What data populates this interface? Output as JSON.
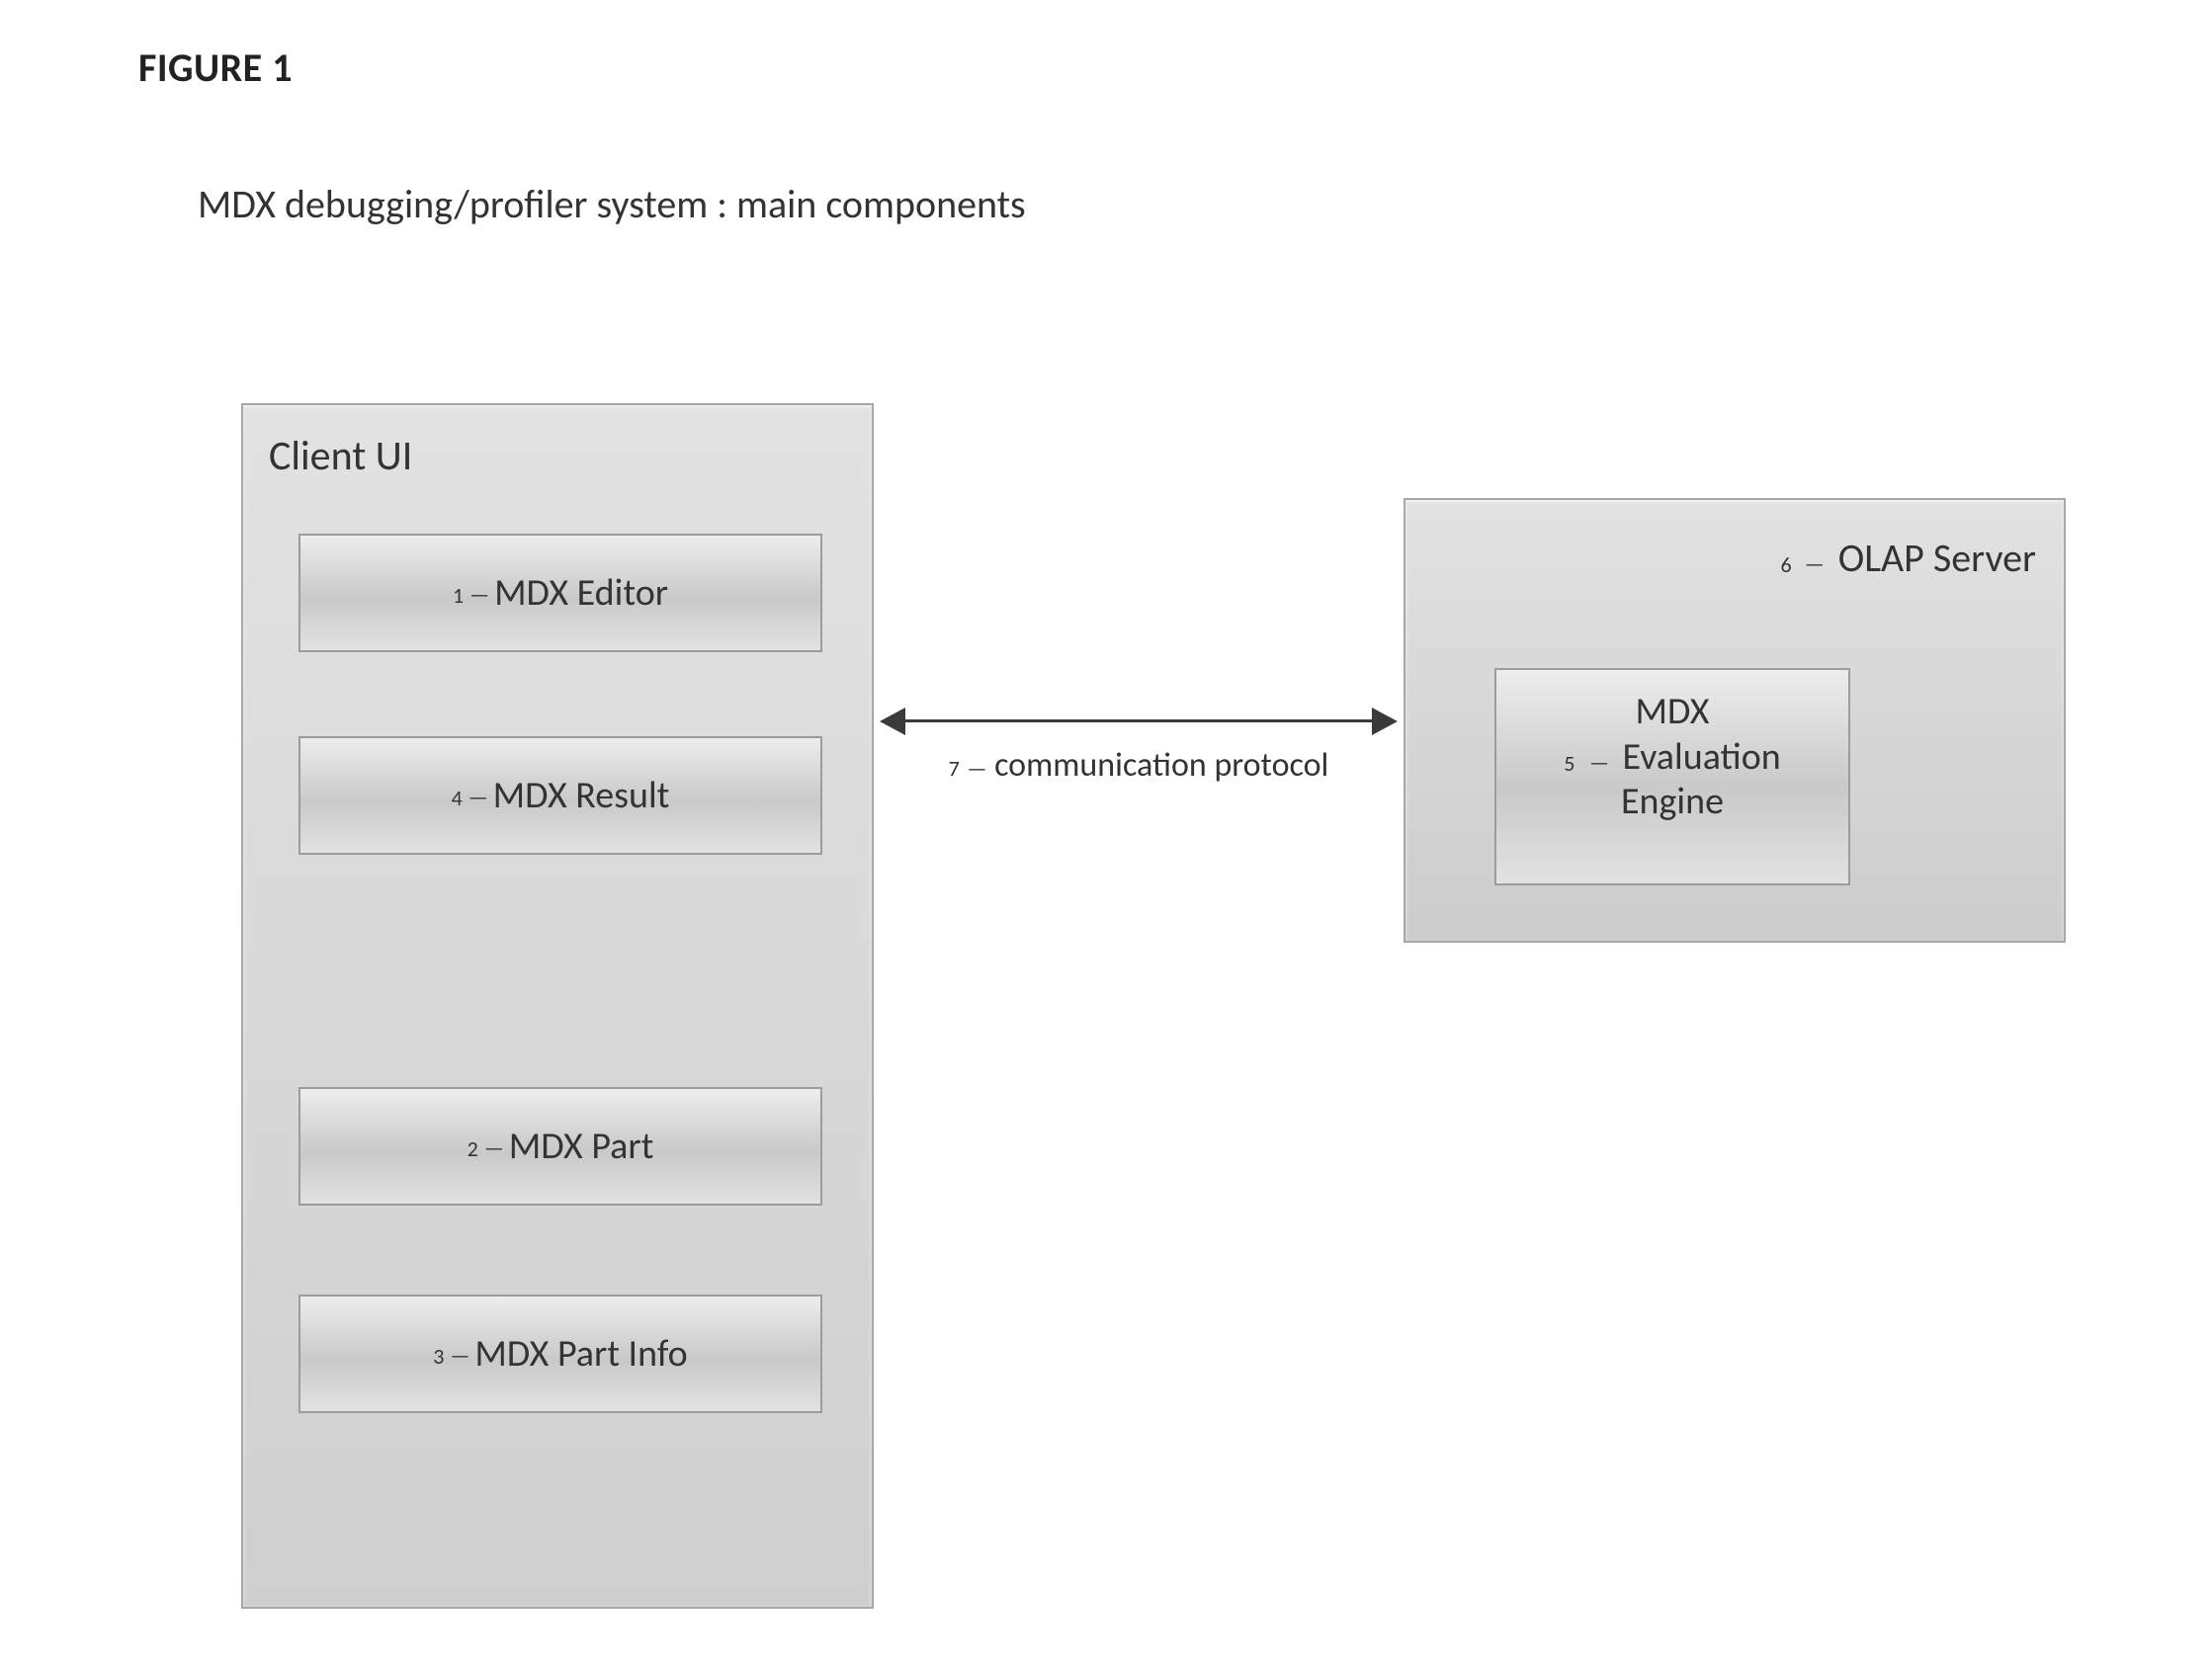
{
  "figure": {
    "title": "FIGURE 1",
    "subtitle": "MDX debugging/profiler system : main components"
  },
  "client_panel": {
    "label": "Client UI",
    "boxes": {
      "editor": {
        "ref": "1",
        "dash": "—",
        "label": "MDX Editor"
      },
      "result": {
        "ref": "4",
        "dash": "—",
        "label": "MDX Result"
      },
      "part": {
        "ref": "2",
        "dash": "—",
        "label": "MDX Part"
      },
      "info": {
        "ref": "3",
        "dash": "—",
        "label": "MDX Part Info"
      }
    }
  },
  "olap_panel": {
    "ref": "6",
    "dash": "—",
    "label": "OLAP Server",
    "engine": {
      "line1": "MDX",
      "ref": "5",
      "dash": "—",
      "line2": "Evaluation",
      "line3": "Engine"
    }
  },
  "connector": {
    "ref": "7",
    "dash": "—",
    "label": "communication protocol"
  }
}
